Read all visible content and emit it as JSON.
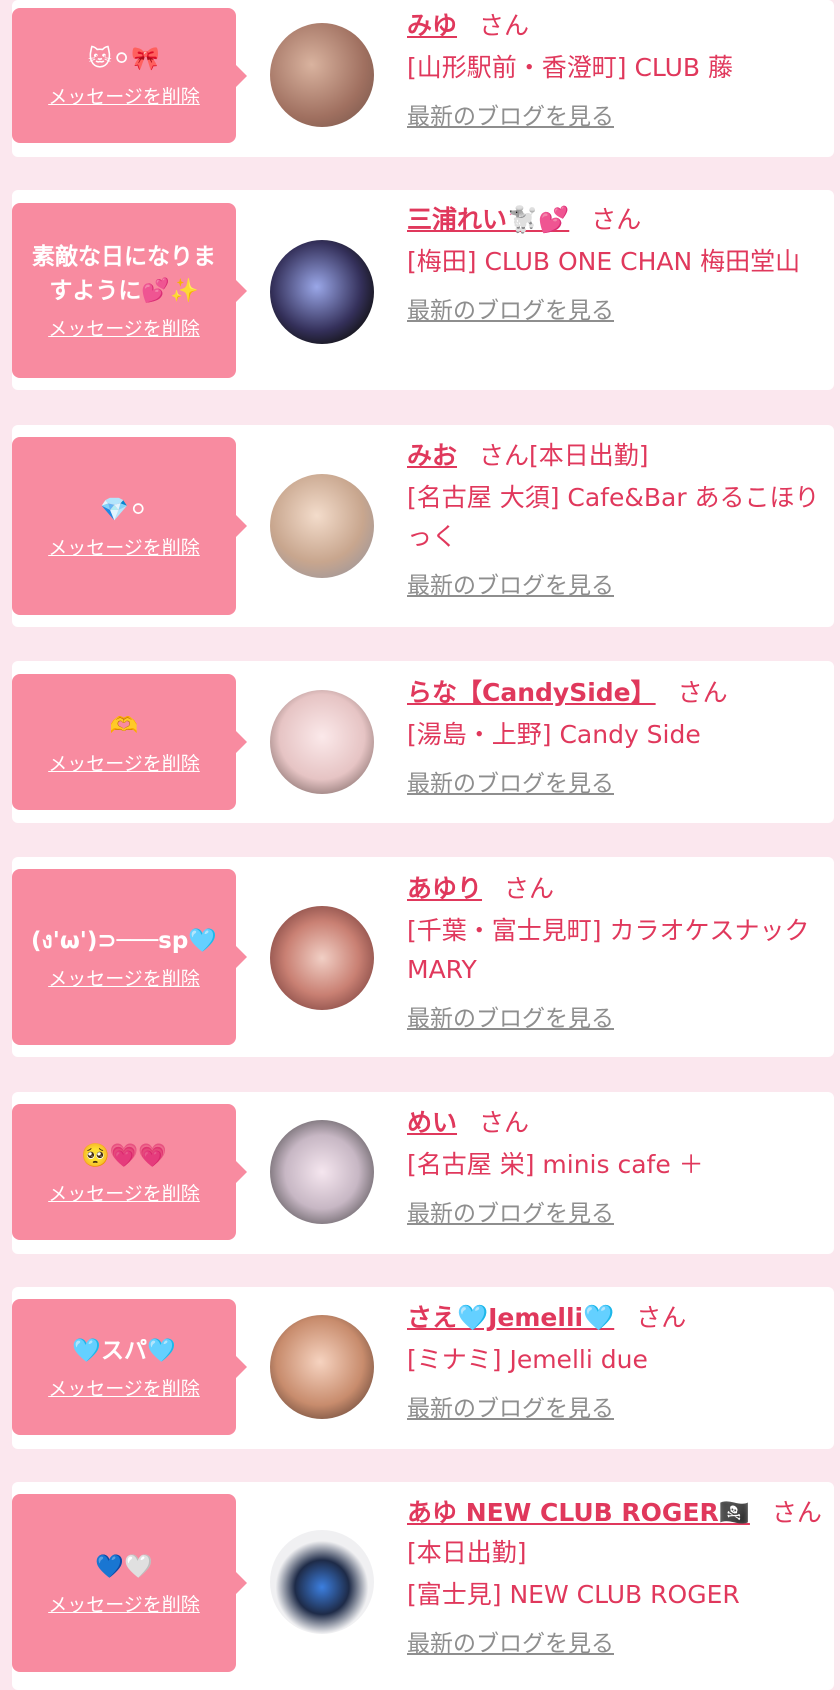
{
  "delete_label": "メッセージを削除",
  "blog_label": "最新のブログを見る",
  "suffix": "さん",
  "colors": {
    "accent": "#e0385c",
    "bubble": "#f88ba0",
    "background": "#fbe7ee"
  },
  "entries": [
    {
      "message": "🐱⚪🎀",
      "name": "みゆ",
      "suffix_extra": "",
      "shop": "[山形駅前・香澄町] CLUB 藤"
    },
    {
      "message": "素敵な日になりますように💕✨",
      "name": "三浦れい🐩💕",
      "suffix_extra": "",
      "shop": "[梅田] CLUB ONE CHAN 梅田堂山"
    },
    {
      "message": "💎⚪",
      "name": "みお",
      "suffix_extra": "[本日出勤]",
      "shop": "[名古屋 大須] Cafe&Bar あるこほりっく"
    },
    {
      "message": "🫶",
      "name": "らな【CandySide】",
      "suffix_extra": "",
      "shop": "[湯島・上野] Candy Side"
    },
    {
      "message": "(ง'ω')⊃───sp🩵",
      "name": "あゆり",
      "suffix_extra": "",
      "shop": "[千葉・富士見町] カラオケスナック MARY"
    },
    {
      "message": "🥺💗💗",
      "name": "めい",
      "suffix_extra": "",
      "shop": "[名古屋 栄] minis cafe ＋"
    },
    {
      "message": "🩵スパ🩵",
      "name": "さえ🩵Jemelli🩵",
      "suffix_extra": "",
      "shop": "[ミナミ] Jemelli due"
    },
    {
      "message": "💙🤍",
      "name": "あゆ NEW CLUB ROGER🏴‍☠️",
      "suffix_extra": "[本日出勤]",
      "shop": "[富士見] NEW CLUB ROGER"
    }
  ]
}
